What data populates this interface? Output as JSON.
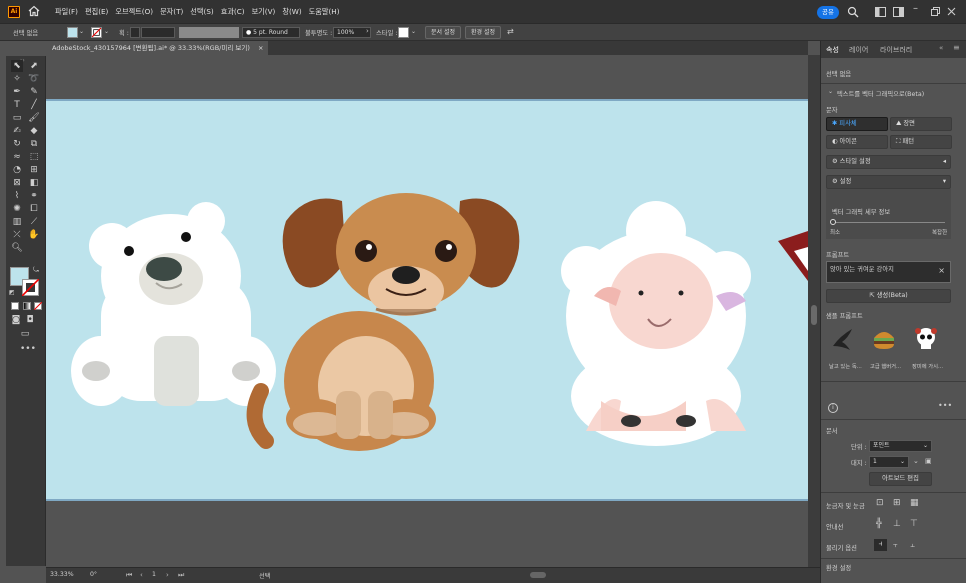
{
  "app": {
    "logo": "Ai",
    "share_label": "공유"
  },
  "menu": [
    "파일(F)",
    "편집(E)",
    "오브젝트(O)",
    "문자(T)",
    "선택(S)",
    "효과(C)",
    "보기(V)",
    "창(W)",
    "도움말(H)"
  ],
  "control": {
    "selection_label": "선택 없음",
    "stroke_label": "획 :",
    "brush_value": "5 pt. Round",
    "opacity_label": "불투명도 :",
    "opacity_value": "100%",
    "style_label": "스타일 :",
    "doc_setup_button": "문서 설정",
    "prefs_button": "환경 설정"
  },
  "document_tab": {
    "title": "AdobeStock_430157964 [변환됨].ai* @ 33.33%(RGB/미리 보기)",
    "close": "×"
  },
  "status_bar": {
    "zoom": "33.33%",
    "rotation": "0°",
    "artboard_number": "1",
    "tool": "선택"
  },
  "panel": {
    "tabs": [
      "속성",
      "레이어",
      "라이브러리"
    ],
    "selection_none": "선택 없음",
    "text_to_vector_header": "텍스트를 벡터 그래픽으로(Beta)",
    "type_label": "문자",
    "type_buttons": [
      "피사체",
      "장면",
      "아이콘",
      "패턴"
    ],
    "style_picker_label": "스타일 설정",
    "settings_label": "설정",
    "detail_label": "벡터 그래픽 세부 정보",
    "detail_min": "최소",
    "detail_max": "복잡한",
    "prompt_label": "프롬프트",
    "prompt_value": "앉아 있는 귀여운 강아지",
    "generate_button": "생성(Beta)",
    "sample_prompts_label": "샘플 프롬프트",
    "samples": [
      {
        "caption": "날고 있는 독...",
        "icon": "bird-icon"
      },
      {
        "caption": "고급 햄버거...",
        "icon": "burger-icon"
      },
      {
        "caption": "장미에 가시...",
        "icon": "skull-icon"
      }
    ],
    "document_label": "문서",
    "unit_label": "단위 :",
    "unit_value": "포인트",
    "artboard_label": "대지 :",
    "artboard_value": "1",
    "edit_artboards_button": "아트보드 편집",
    "rulers_label": "눈금자 및 눈금",
    "guides_label": "안내선",
    "snap_label": "물리기 옵션",
    "prefs_label": "환경 설정"
  },
  "colors": {
    "accent": "#1473e6",
    "artboard": "#bde3ec",
    "ui_dark": "#323232",
    "ui_mid": "#535353"
  }
}
